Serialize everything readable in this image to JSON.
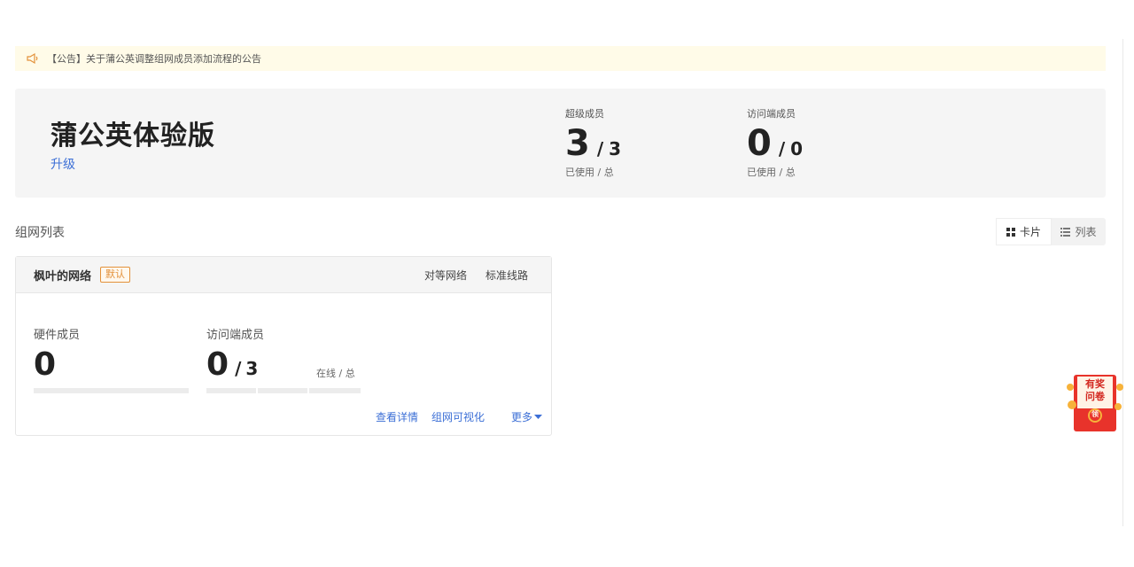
{
  "notice": {
    "icon": "speaker-icon",
    "text": "【公告】关于蒲公英调整组网成员添加流程的公告"
  },
  "plan": {
    "name": "蒲公英体验版",
    "upgrade_label": "升级"
  },
  "stats": [
    {
      "label": "超级成员",
      "used": "3",
      "slash": "/",
      "total": "3",
      "sub": "已使用 / 总"
    },
    {
      "label": "访问端成员",
      "used": "0",
      "slash": "/",
      "total": "0",
      "sub": "已使用 / 总"
    }
  ],
  "section_title": "组网列表",
  "view_toggle": {
    "card_label": "卡片",
    "list_label": "列表",
    "active": "card"
  },
  "network_card": {
    "name": "枫叶的网络",
    "badge": "默认",
    "tags": [
      "对等网络",
      "标准线路"
    ],
    "hardware": {
      "label": "硬件成员",
      "count": "0"
    },
    "access": {
      "label": "访问端成员",
      "online": "0",
      "slash": "/",
      "total": "3",
      "status_label": "在线 / 总"
    },
    "links": [
      "查看详情",
      "组网可视化",
      "更多"
    ]
  },
  "survey_badge": {
    "line1": "有奖",
    "line2": "问卷",
    "seal": "领"
  },
  "colors": {
    "accent_link": "#3c6fd6",
    "badge_orange": "#e3913a",
    "notice_bg": "#fffbe8",
    "summary_bg": "#f5f5f5",
    "survey_red": "#e8332b"
  }
}
